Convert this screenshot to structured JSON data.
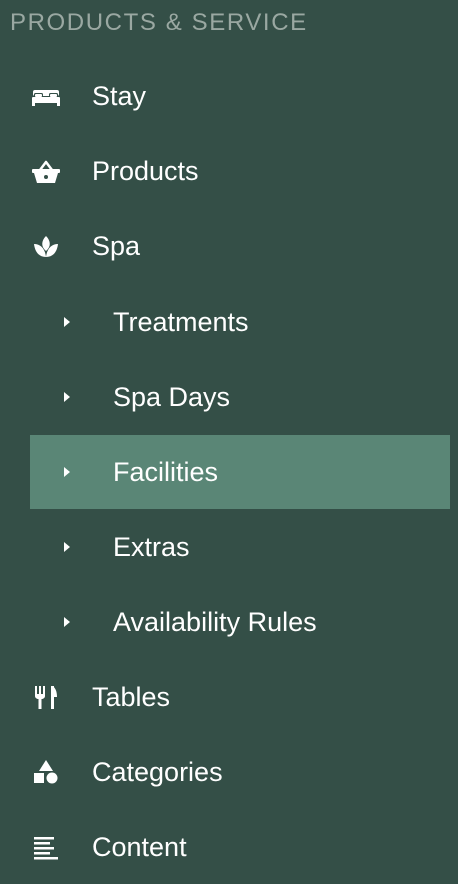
{
  "sidebar": {
    "section_title": "PRODUCTS & SERVICE",
    "accent_color": "#5a8676",
    "background_color": "#344f47",
    "items": [
      {
        "label": "Stay",
        "icon": "bed-icon"
      },
      {
        "label": "Products",
        "icon": "basket-icon"
      },
      {
        "label": "Spa",
        "icon": "lotus-icon",
        "expanded": true,
        "children": [
          {
            "label": "Treatments"
          },
          {
            "label": "Spa Days"
          },
          {
            "label": "Facilities",
            "active": true
          },
          {
            "label": "Extras"
          },
          {
            "label": "Availability Rules"
          }
        ]
      },
      {
        "label": "Tables",
        "icon": "cutlery-icon"
      },
      {
        "label": "Categories",
        "icon": "shapes-icon"
      },
      {
        "label": "Content",
        "icon": "text-lines-icon"
      }
    ]
  }
}
